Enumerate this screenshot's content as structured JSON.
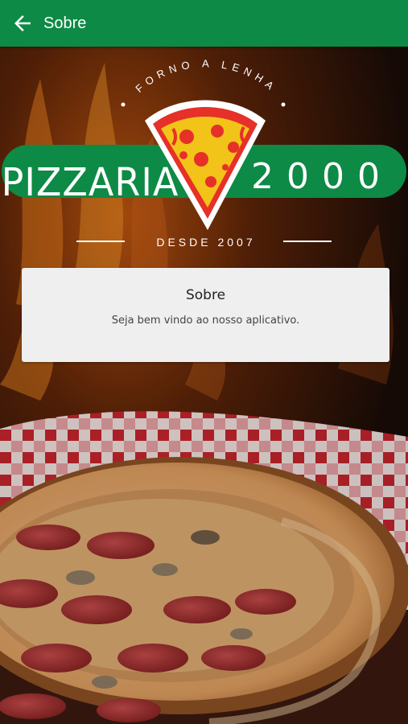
{
  "appbar": {
    "title": "Sobre",
    "back_icon": "arrow-left-icon",
    "color": "#0d8a45"
  },
  "logo": {
    "top_text": "FORNO A LENHA",
    "left_word": "PIZZARIA",
    "right_word": "2000",
    "bottom_text": "DESDE 2007",
    "banner_color": "#0d8a45",
    "slice_color": "#f2c318",
    "crust_color": "#e63028"
  },
  "card": {
    "title": "Sobre",
    "text": "Seja bem vindo ao nosso aplicativo."
  }
}
